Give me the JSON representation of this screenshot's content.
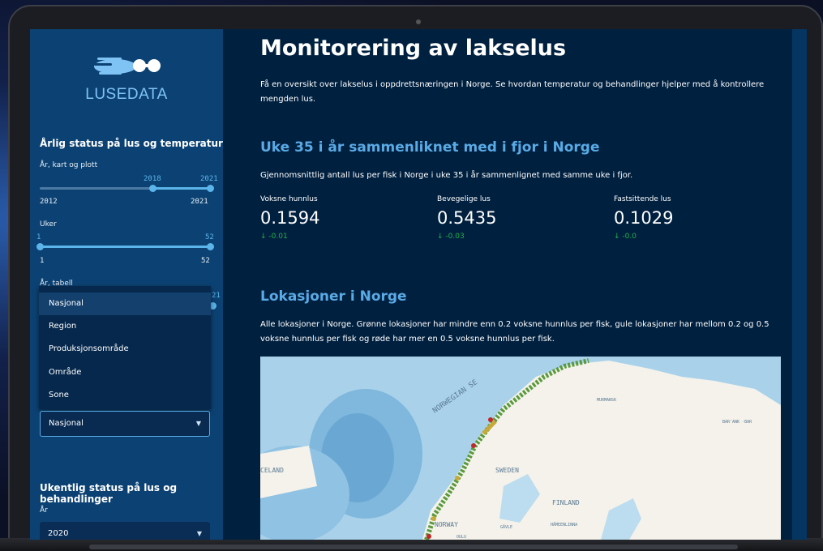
{
  "sidebar": {
    "logo_text": "LUSEDATA",
    "annual_heading": "Årlig status på lus og temperatur",
    "year_slider": {
      "label": "År, kart og plott",
      "min": "2012",
      "max": "2021",
      "value_low": "2018",
      "value_high": "2021"
    },
    "weeks_slider": {
      "label": "Uker",
      "min": "1",
      "max": "52",
      "value_low": "1",
      "value_high": "52"
    },
    "table_year_label": "År, tabell",
    "hidden_value_fragment": "21",
    "dropdown_options": [
      "Nasjonal",
      "Region",
      "Produksjonsområde",
      "Område",
      "Sone"
    ],
    "selected_level": "Nasjonal",
    "weekly_heading": "Ukentlig status på lus og behandlinger",
    "weekly_year_label": "År",
    "weekly_year_value": "2020"
  },
  "main": {
    "title": "Monitorering av lakselus",
    "intro": "Få en oversikt over lakselus i oppdrettsnæringen i Norge. Se hvordan temperatur og behandlinger hjelper med å kontrollere mengden lus.",
    "week_heading": "Uke 35 i år sammenliknet med i fjor i Norge",
    "week_desc": "Gjennomsnittlig antall lus per fisk i Norge i uke 35 i år sammenlignet med samme uke i fjor.",
    "metrics": [
      {
        "label": "Voksne hunnlus",
        "value": "0.1594",
        "delta": "-0.01"
      },
      {
        "label": "Bevegelige lus",
        "value": "0.5435",
        "delta": "-0.03"
      },
      {
        "label": "Fastsittende lus",
        "value": "0.1029",
        "delta": "-0.0"
      }
    ],
    "locations_heading": "Lokasjoner i Norge",
    "locations_desc": "Alle lokasjoner i Norge. Grønne lokasjoner har mindre enn 0.2 voksne hunnlus per fisk, gule lokasjoner har mellom 0.2 og 0.5 voksne hunnlus per fisk og røde har mer en 0.5 voksne hunnlus per fisk.",
    "map_labels": {
      "sea": "NORWEGIAN SE",
      "iceland": "CELAND",
      "sweden": "SWEDEN",
      "finland": "FINLAND",
      "norway": "NORWAY",
      "murmansk": "MURMANSK",
      "barents": "BAR'ANK ·BAR",
      "oulu": "OULU",
      "gavle": "GÄVLE",
      "hameenlinna": "HÄMEENLINNA"
    },
    "delta_icon": "arrow-down-icon"
  },
  "colors": {
    "sidebar_bg": "#0c4273",
    "main_bg": "#00203f",
    "accent": "#5aaae6",
    "delta_green": "#22b14c"
  }
}
